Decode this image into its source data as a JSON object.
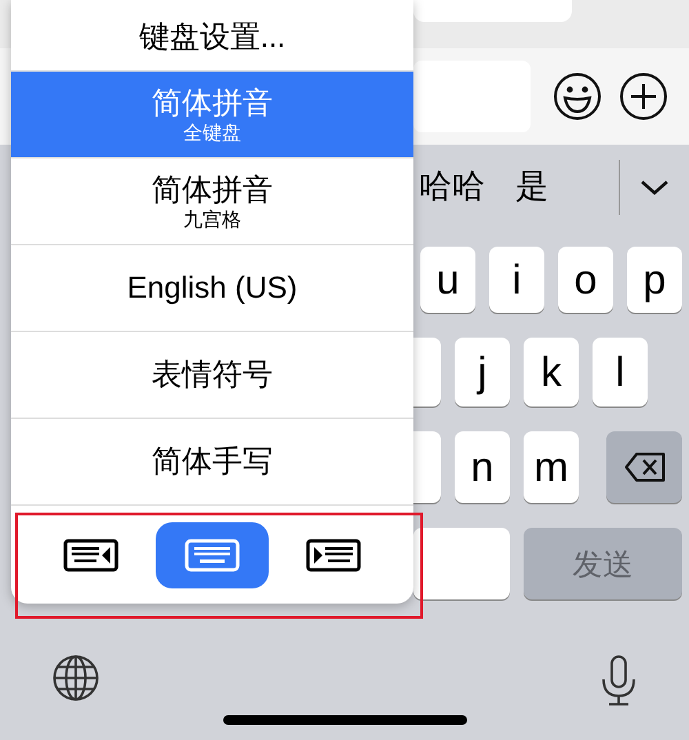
{
  "menu": {
    "items": [
      {
        "kind": "plain",
        "label": "键盘设置...",
        "selected": false
      },
      {
        "kind": "double",
        "label": "简体拼音",
        "sublabel": "全键盘",
        "selected": true
      },
      {
        "kind": "double",
        "label": "简体拼音",
        "sublabel": "九宫格",
        "selected": false
      },
      {
        "kind": "plain",
        "label": "English (US)",
        "selected": false
      },
      {
        "kind": "plain",
        "label": "表情符号",
        "selected": false
      },
      {
        "kind": "plain",
        "label": "简体手写",
        "selected": false
      }
    ],
    "layout_buttons": [
      {
        "kind": "left",
        "selected": false
      },
      {
        "kind": "full",
        "selected": true
      },
      {
        "kind": "right",
        "selected": false
      }
    ]
  },
  "candidates": [
    "哈哈",
    "是"
  ],
  "keys": {
    "row_1": [
      "u",
      "i",
      "o",
      "p"
    ],
    "row_2": [
      "j",
      "k",
      "l"
    ],
    "row_3": [
      "n",
      "m"
    ]
  },
  "send_button": {
    "label": "发送",
    "disabled": true
  }
}
